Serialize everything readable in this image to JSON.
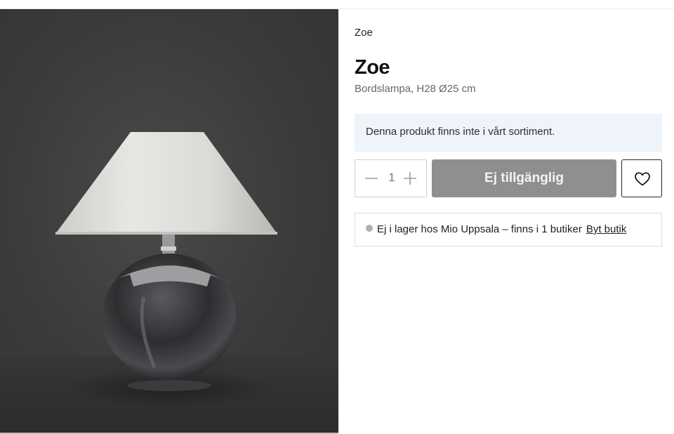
{
  "product": {
    "brand": "Zoe",
    "title": "Zoe",
    "subtitle": "Bordslampa, H28 Ø25 cm",
    "image_subject": "lamp-photo"
  },
  "notice": {
    "text": "Denna produkt finns inte i vårt sortiment.",
    "background": "#eff4fb"
  },
  "purchase": {
    "quantity": "1",
    "minus_icon": "minus-icon",
    "plus_icon": "plus-icon",
    "button_label": "Ej tillgänglig",
    "button_color": "#8f8f8f",
    "wishlist_icon": "heart-icon"
  },
  "stock": {
    "status_color": "#b0b0b0",
    "text": "Ej i lager hos Mio Uppsala – finns i 1 butiker",
    "link_label": "Byt butik"
  }
}
